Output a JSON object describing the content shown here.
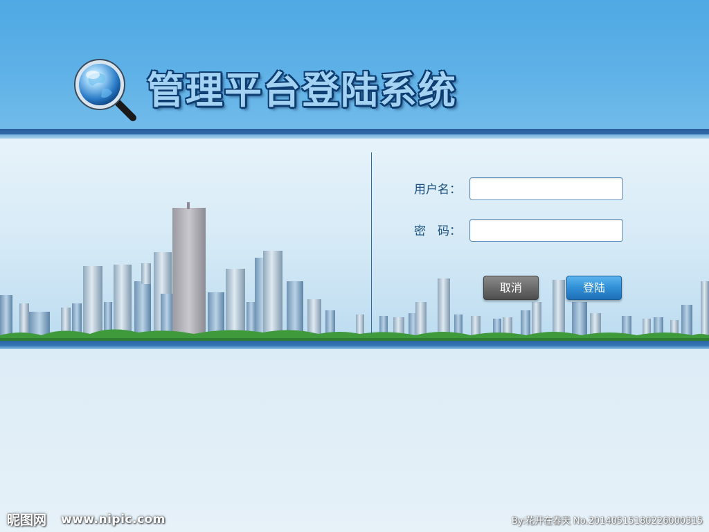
{
  "header": {
    "title": "管理平台登陆系统",
    "logo_icon": "globe-magnifier-icon"
  },
  "login_form": {
    "username_label": "用户名：",
    "username_value": "",
    "password_label": "密　码：",
    "password_value": "",
    "cancel_label": "取消",
    "login_label": "登陆"
  },
  "watermark": {
    "site_logo": "昵图网",
    "site_url": "www.nipic.com",
    "credit": "By:花开在春天  No.20140515180226000315"
  },
  "colors": {
    "header_blue": "#5eb1e7",
    "band_dark": "#2d66a3",
    "label_text": "#1b4f80",
    "login_button": "#2f8fd6",
    "cancel_button": "#6b6b6b"
  }
}
